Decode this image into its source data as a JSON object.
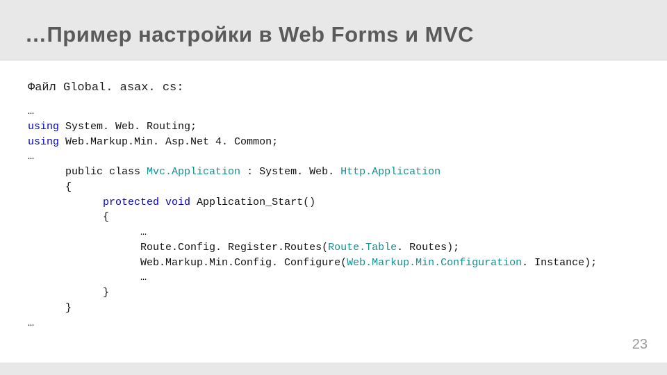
{
  "slide": {
    "title": "…Пример настройки в Web Forms и MVC",
    "file_label": "Файл Global. asax. cs:",
    "page_number": "23"
  },
  "code": {
    "l01": "…",
    "l02a": "using",
    "l02b": " System. Web. Routing;",
    "l03a": "using",
    "l03b": " Web.Markup.Min. Asp.Net 4. Common;",
    "l04": "…",
    "l05a": "      public class ",
    "l05b": "Mvc.Application ",
    "l05c": ": System. Web. ",
    "l05d": "Http.Application",
    "l06": "      {",
    "l07a": "            protected void",
    "l07b": " Application_Start()",
    "l08": "            {",
    "l09": "                  …",
    "l10a": "                  Route.Config. Register.Routes(",
    "l10b": "Route.Table",
    "l10c": ". Routes);",
    "l11a": "                  Web.Markup.Min.Config. Configure(",
    "l11b": "Web.Markup.Min.Configuration",
    "l11c": ". Instance);",
    "l12": "                  …",
    "l13": "            }",
    "l14": "      }",
    "l15": "…"
  }
}
